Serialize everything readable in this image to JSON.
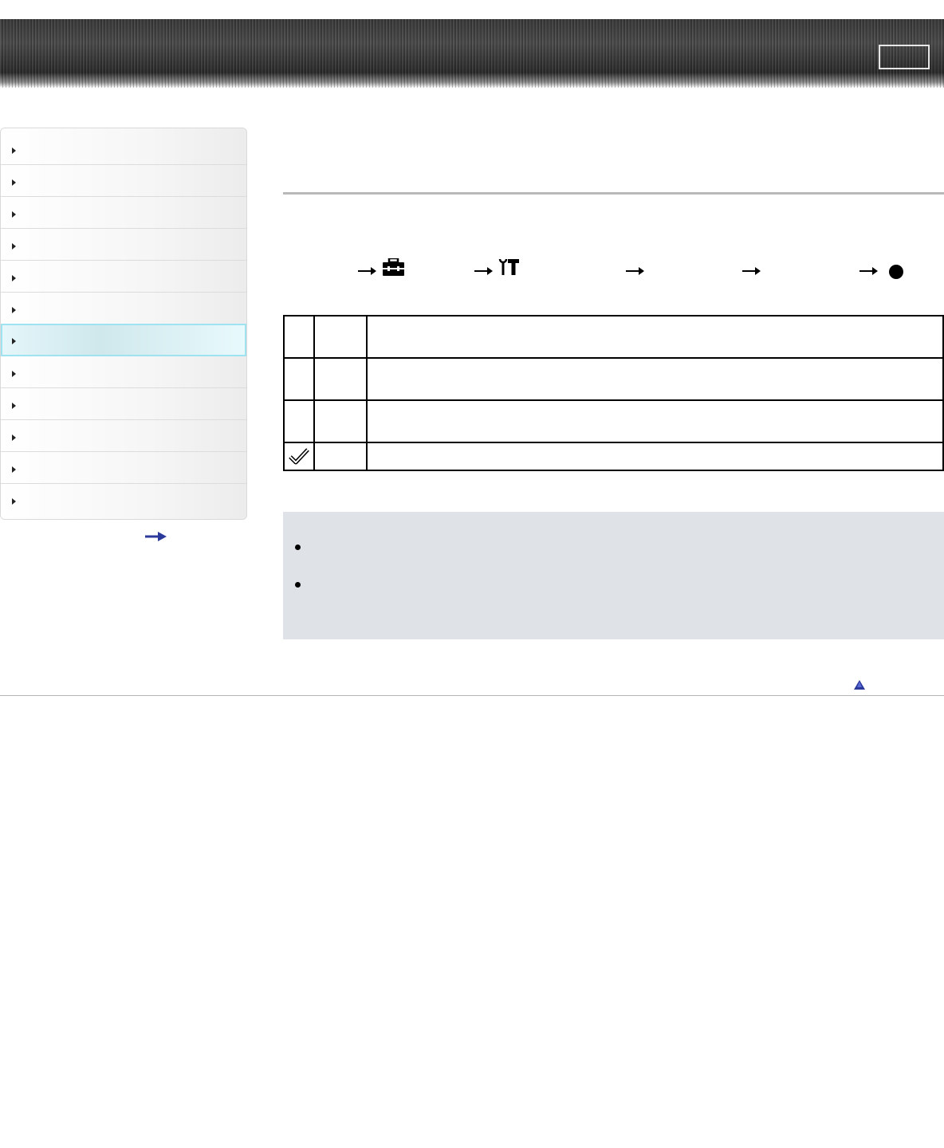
{
  "header": {
    "title": "",
    "box_label": ""
  },
  "sidebar": {
    "items": [
      {
        "label": "",
        "active": false
      },
      {
        "label": "",
        "active": false
      },
      {
        "label": "",
        "active": false
      },
      {
        "label": "",
        "active": false
      },
      {
        "label": "",
        "active": false
      },
      {
        "label": "",
        "active": false
      },
      {
        "label": "",
        "active": true
      },
      {
        "label": "",
        "active": false
      },
      {
        "label": "",
        "active": false
      },
      {
        "label": "",
        "active": false
      },
      {
        "label": "",
        "active": false
      },
      {
        "label": "",
        "active": false
      }
    ],
    "more_link_icon": "right-arrow-icon"
  },
  "main": {
    "page_title": "",
    "menu_path": {
      "icons": [
        "toolbox-icon",
        "wrench-settings-icon",
        "filled-circle-icon"
      ],
      "steps": [
        "",
        "",
        "",
        "",
        "",
        ""
      ]
    },
    "table": {
      "rows": [
        {
          "icon": "",
          "name": "",
          "description": ""
        },
        {
          "icon": "",
          "name": "",
          "description": ""
        },
        {
          "icon": "",
          "name": "",
          "description": ""
        },
        {
          "icon": "checkmark-icon",
          "name": "",
          "description": ""
        }
      ]
    },
    "notes": [
      {
        "text": ""
      },
      {
        "text": ""
      }
    ]
  },
  "footer": {
    "back_to_top_icon": "up-triangle-icon"
  },
  "colors": {
    "header_dark": "#3a3a3a",
    "sidebar_active_border": "#9fe3f0",
    "note_background": "#dfe2e6",
    "link_blue": "#2b3a9a"
  }
}
